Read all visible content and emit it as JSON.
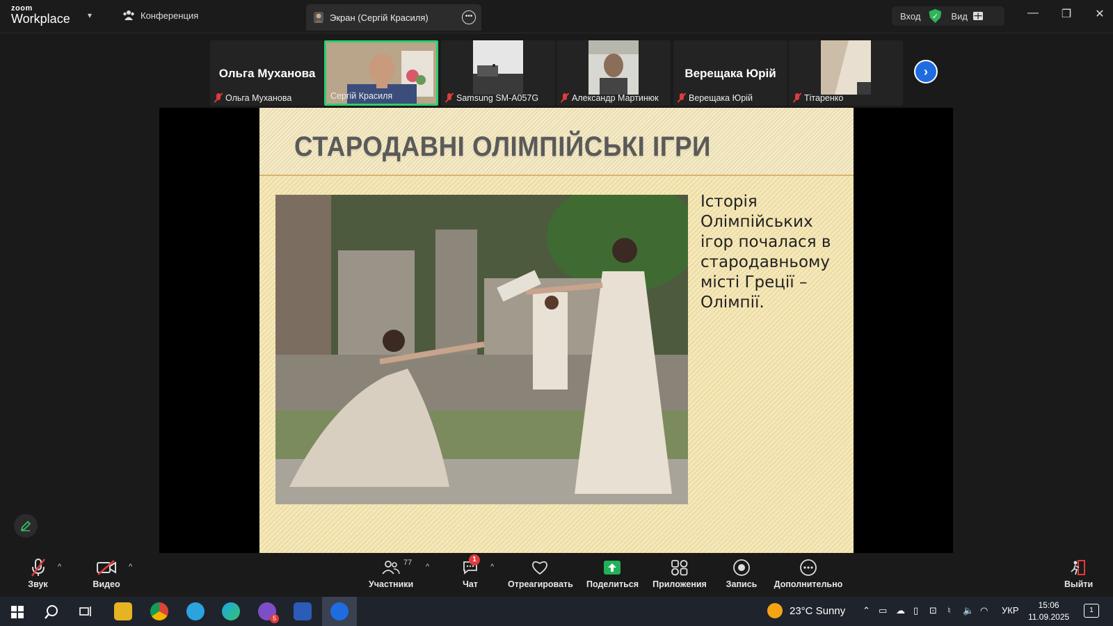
{
  "titlebar": {
    "logo_small": "zoom",
    "logo_big": "Workplace",
    "conference_tab": "Конференция",
    "screen_tab": "Экран (Сергій Красиля)",
    "login_label": "Вход",
    "view_label": "Вид"
  },
  "participants": [
    {
      "big_name": "Ольга Муханова",
      "caption": "Ольга Муханова",
      "muted": true,
      "video": false
    },
    {
      "big_name": "",
      "caption": "Сергій Красиля",
      "muted": false,
      "video": true,
      "active": true
    },
    {
      "big_name": "",
      "caption": "Samsung SM-A057G",
      "muted": true,
      "video": true
    },
    {
      "big_name": "",
      "caption": "Александр Мартинюк",
      "muted": true,
      "video": true
    },
    {
      "big_name": "Верещака Юрій",
      "caption": "Верещака Юрій",
      "muted": true,
      "video": false
    },
    {
      "big_name": "",
      "caption": "Тітаренко",
      "muted": true,
      "video": true
    }
  ],
  "slide": {
    "title": "СТАРОДАВНІ ОЛІМПІЙСЬКІ ІГРИ",
    "body": "Історія Олімпійських ігор почалася в стародавньому місті Греції – Олімпії."
  },
  "toolbar": {
    "audio": "Звук",
    "video": "Видео",
    "participants": "Участники",
    "participants_count": "77",
    "chat": "Чат",
    "chat_badge": "1",
    "react": "Отреагировать",
    "share": "Поделиться",
    "apps": "Приложения",
    "record": "Запись",
    "more": "Дополнительно",
    "leave": "Выйти"
  },
  "taskbar": {
    "weather": "23°C  Sunny",
    "language": "УКР",
    "time": "15:06",
    "date": "11.09.2025",
    "notifications": "1",
    "viber_badge": "5"
  },
  "colors": {
    "accent_blue": "#1f6ce0",
    "active_green": "#2fcd70",
    "muted_red": "#e03b3b",
    "share_green": "#22b05a"
  }
}
